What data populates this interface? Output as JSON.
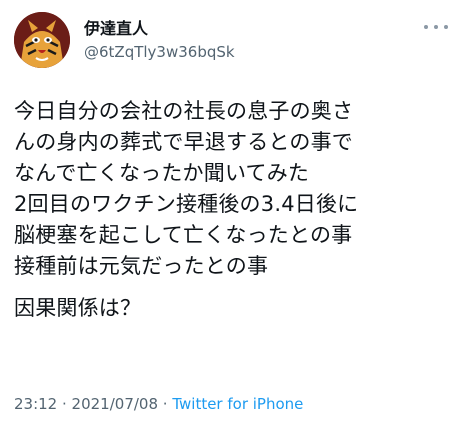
{
  "user": {
    "display_name": "伊達直人",
    "handle": "@6tZqTly3w36bqSk",
    "avatar_icon": "tiger-mask-avatar"
  },
  "tweet": {
    "lines": [
      "今日自分の会社の社長の息子の奥さ",
      "んの身内の葬式で早退するとの事で",
      "なんで亡くなったか聞いてみた",
      "2回目のワクチン接種後の3.4日後に",
      "脳梗塞を起こして亡くなったとの事",
      "接種前は元気だったとの事"
    ],
    "question": "因果関係は？"
  },
  "meta": {
    "time": "23:12",
    "separator1": " · ",
    "date": "2021/07/08",
    "separator2": " · ",
    "source": "Twitter for iPhone"
  },
  "colors": {
    "text": "#0f1419",
    "muted": "#536471",
    "link": "#1d9bf0"
  }
}
